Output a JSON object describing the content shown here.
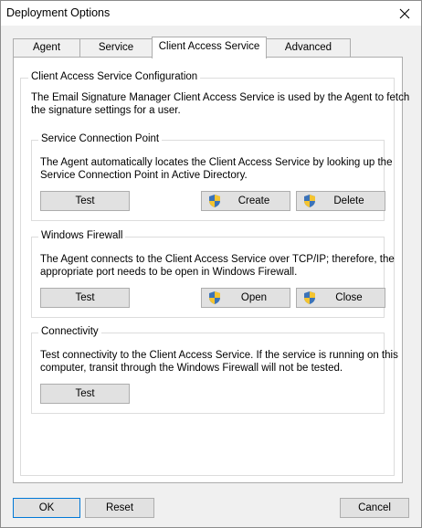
{
  "window": {
    "title": "Deployment Options",
    "close_icon": "close-icon"
  },
  "tabs": [
    {
      "label": "Agent",
      "active": false
    },
    {
      "label": "Service",
      "active": false
    },
    {
      "label": "Client Access Service",
      "active": true
    },
    {
      "label": "Advanced",
      "active": false
    }
  ],
  "config": {
    "heading": "Client Access Service Configuration",
    "description_lines": [
      "The Email Signature Manager Client Access Service is used by the Agent to fetch",
      "the signature settings for a user."
    ]
  },
  "scp": {
    "heading": "Service Connection Point",
    "description_lines": [
      "The Agent automatically locates the Client Access Service by looking up the",
      "Service Connection Point in Active Directory."
    ],
    "test_label": "Test",
    "create_label": "Create",
    "delete_label": "Delete"
  },
  "firewall": {
    "heading": "Windows Firewall",
    "description_lines": [
      "The Agent connects to the Client Access Service over TCP/IP; therefore, the",
      "appropriate port needs to be open in Windows Firewall."
    ],
    "test_label": "Test",
    "open_label": "Open",
    "close_label": "Close"
  },
  "connectivity": {
    "heading": "Connectivity",
    "description_lines": [
      "Test connectivity to the Client Access Service. If the service is running on this",
      "computer, transit through the Windows Firewall will not be tested."
    ],
    "test_label": "Test"
  },
  "footer": {
    "ok_label": "OK",
    "reset_label": "Reset",
    "cancel_label": "Cancel"
  },
  "colors": {
    "accent": "#0078d7",
    "button_face": "#e1e1e1",
    "border": "#adadad"
  }
}
